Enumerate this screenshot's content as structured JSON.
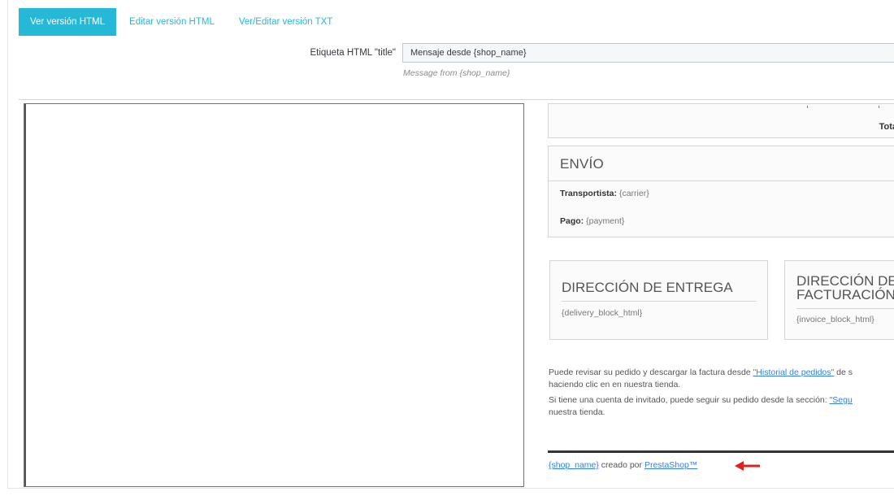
{
  "tabs": [
    {
      "label": "Ver versión HTML"
    },
    {
      "label": "Editar versión HTML"
    },
    {
      "label": "Ver/Editar versión TXT"
    }
  ],
  "title_field": {
    "label": "Etiqueta HTML \"title\"",
    "value": "Mensaje desde {shop_name}",
    "help": "Message from {shop_name}"
  },
  "preview": {
    "total_label": "Total pa",
    "shipping": {
      "heading": "ENVÍO",
      "carrier_label": "Transportista:",
      "carrier_value": "{carrier}",
      "payment_label": "Pago:",
      "payment_value": "{payment}"
    },
    "delivery": {
      "heading": "DIRECCIÓN DE ENTREGA",
      "value": "{delivery_block_html}"
    },
    "invoice": {
      "heading_line1": "DIRECCIÓN DE",
      "heading_line2": "FACTURACIÓN",
      "value": "{invoice_block_html}"
    },
    "para1": {
      "text_before": "Puede revisar su pedido y descargar la factura desde ",
      "link": "\"Historial de pedidos\"",
      "text_after": " de s",
      "line2": "haciendo clic en en nuestra tienda."
    },
    "para2": {
      "text_before": "Si tiene una cuenta de invitado, puede seguir su pedido desde la sección: ",
      "link": "\"Segu",
      "line2": "nuestra tienda."
    },
    "footer": {
      "shop_link": "{shop_name}",
      "text": " creado por ",
      "brand_link": "PrestaShop™"
    },
    "arrow_color": "#e0201f"
  }
}
